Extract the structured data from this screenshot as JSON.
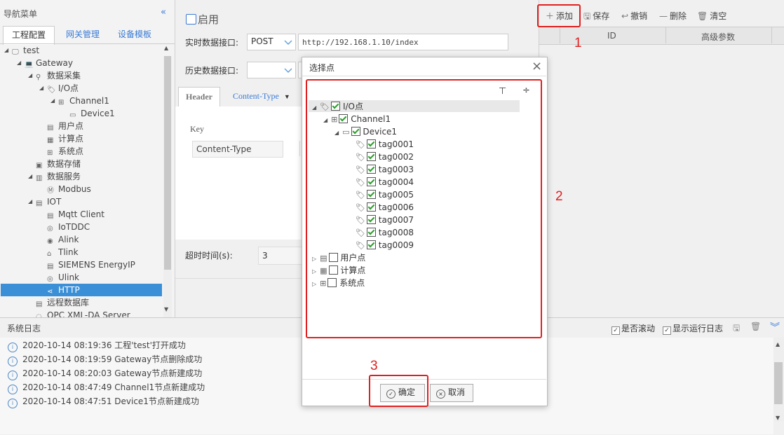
{
  "nav": {
    "title": "导航菜单",
    "collapse": "«",
    "tabs": [
      "工程配置",
      "网关管理",
      "设备模板"
    ],
    "tree": [
      {
        "label": "test",
        "level": 0,
        "icon": "monitor-icon"
      },
      {
        "label": "Gateway",
        "level": 1,
        "icon": "computer-icon"
      },
      {
        "label": "数据采集",
        "level": 2,
        "icon": "data-collect-icon"
      },
      {
        "label": "I/O点",
        "level": 3,
        "icon": "tag-icon"
      },
      {
        "label": "Channel1",
        "level": 4,
        "icon": "channel-icon"
      },
      {
        "label": "Device1",
        "level": 5,
        "icon": "device-icon"
      },
      {
        "label": "用户点",
        "level": 3,
        "icon": "user-point-icon"
      },
      {
        "label": "计算点",
        "level": 3,
        "icon": "calc-point-icon"
      },
      {
        "label": "系统点",
        "level": 3,
        "icon": "system-point-icon"
      },
      {
        "label": "数据存储",
        "level": 2,
        "icon": "storage-icon"
      },
      {
        "label": "数据服务",
        "level": 2,
        "icon": "data-service-icon"
      },
      {
        "label": "Modbus",
        "level": 3,
        "icon": "modbus-icon"
      },
      {
        "label": "IOT",
        "level": 2,
        "icon": "iot-icon"
      },
      {
        "label": "Mqtt Client",
        "level": 3,
        "icon": "mqtt-icon"
      },
      {
        "label": "IoTDDC",
        "level": 3,
        "icon": "iotddc-icon"
      },
      {
        "label": "Alink",
        "level": 3,
        "icon": "alink-icon"
      },
      {
        "label": "Tlink",
        "level": 3,
        "icon": "tlink-icon"
      },
      {
        "label": "SIEMENS EnergyIP",
        "level": 3,
        "icon": "siemens-icon"
      },
      {
        "label": "Ulink",
        "level": 3,
        "icon": "ulink-icon"
      },
      {
        "label": "HTTP",
        "level": 3,
        "icon": "share-icon"
      },
      {
        "label": "远程数据库",
        "level": 2,
        "icon": "database-icon"
      },
      {
        "label": "OPC XML-DA Server",
        "level": 2,
        "icon": "opc-icon"
      }
    ]
  },
  "main": {
    "enable_label": "启用",
    "realtime_label": "实时数据接口:",
    "realtime_method": "POST",
    "realtime_url": "http://192.168.1.10/index",
    "history_label": "历史数据接口:",
    "history_method": "",
    "tab_header": "Header",
    "tab_content_type": "Content-Type",
    "key_label": "Key",
    "key_value": "Content-Type",
    "timeout_label": "超时时间(s):",
    "timeout_value": "3"
  },
  "toolbar": {
    "add": "添加",
    "save": "保存",
    "undo": "撤销",
    "delete": "删除",
    "clear": "清空",
    "col_id": "ID",
    "col_adv": "高级参数"
  },
  "dialog": {
    "title": "选择点",
    "close": "×",
    "root": "I/O点",
    "channel": "Channel1",
    "device": "Device1",
    "tags": [
      "tag0001",
      "tag0002",
      "tag0003",
      "tag0004",
      "tag0005",
      "tag0006",
      "tag0007",
      "tag0008",
      "tag0009"
    ],
    "others": [
      "用户点",
      "计算点",
      "系统点"
    ],
    "ok": "确定",
    "cancel": "取消"
  },
  "annotations": {
    "n1": "1",
    "n2": "2",
    "n3": "3"
  },
  "log": {
    "title": "系统日志",
    "scroll_label": "是否滚动",
    "show_run_label": "显示运行日志",
    "entries": [
      "2020-10-14 08:19:36 工程'test'打开成功",
      "2020-10-14 08:19:59 Gateway节点删除成功",
      "2020-10-14 08:20:03 Gateway节点新建成功",
      "2020-10-14 08:47:49 Channel1节点新建成功",
      "2020-10-14 08:47:51 Device1节点新建成功"
    ]
  },
  "colors": {
    "accent": "#3a7bd5",
    "selected": "#3b8fd6",
    "annotation": "#e02020",
    "check": "#2a9d2a"
  }
}
